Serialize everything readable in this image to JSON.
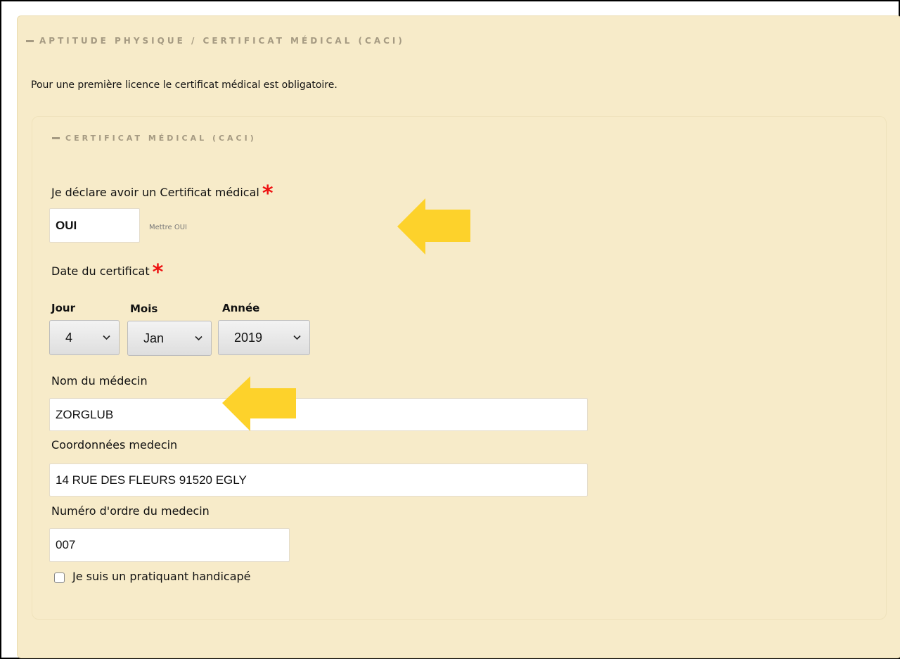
{
  "section": {
    "title": "APTITUDE PHYSIQUE / CERTIFICAT MÉDICAL (CACI)",
    "intro": "Pour une première licence le certificat médical est obligatoire."
  },
  "caci": {
    "title": "CERTIFICAT MÉDICAL (CACI)",
    "declare_label": "Je déclare avoir un Certificat médical",
    "declare_value": "OUI",
    "declare_hint": "Mettre OUI",
    "required_mark": "*",
    "date_label": "Date du certificat",
    "day": {
      "label": "Jour",
      "value": "4"
    },
    "month": {
      "label": "Mois",
      "value": "Jan"
    },
    "year": {
      "label": "Année",
      "value": "2019"
    },
    "doctor_name_label": "Nom du médecin",
    "doctor_name_value": "ZORGLUB",
    "doctor_contact_label": "Coordonnées medecin",
    "doctor_contact_value": "14 RUE DES FLEURS 91520 EGLY",
    "doctor_number_label": "Numéro d'ordre du medecin",
    "doctor_number_value": "007",
    "handicap_label": "Je suis un pratiquant handicapé",
    "handicap_checked": false
  },
  "colors": {
    "panel_bg": "#f7ebc9",
    "arrow": "#fdd22b",
    "required": "#ee1111"
  },
  "icons": [
    "chevron-down-icon",
    "arrow-left-icon",
    "asterisk-icon"
  ]
}
